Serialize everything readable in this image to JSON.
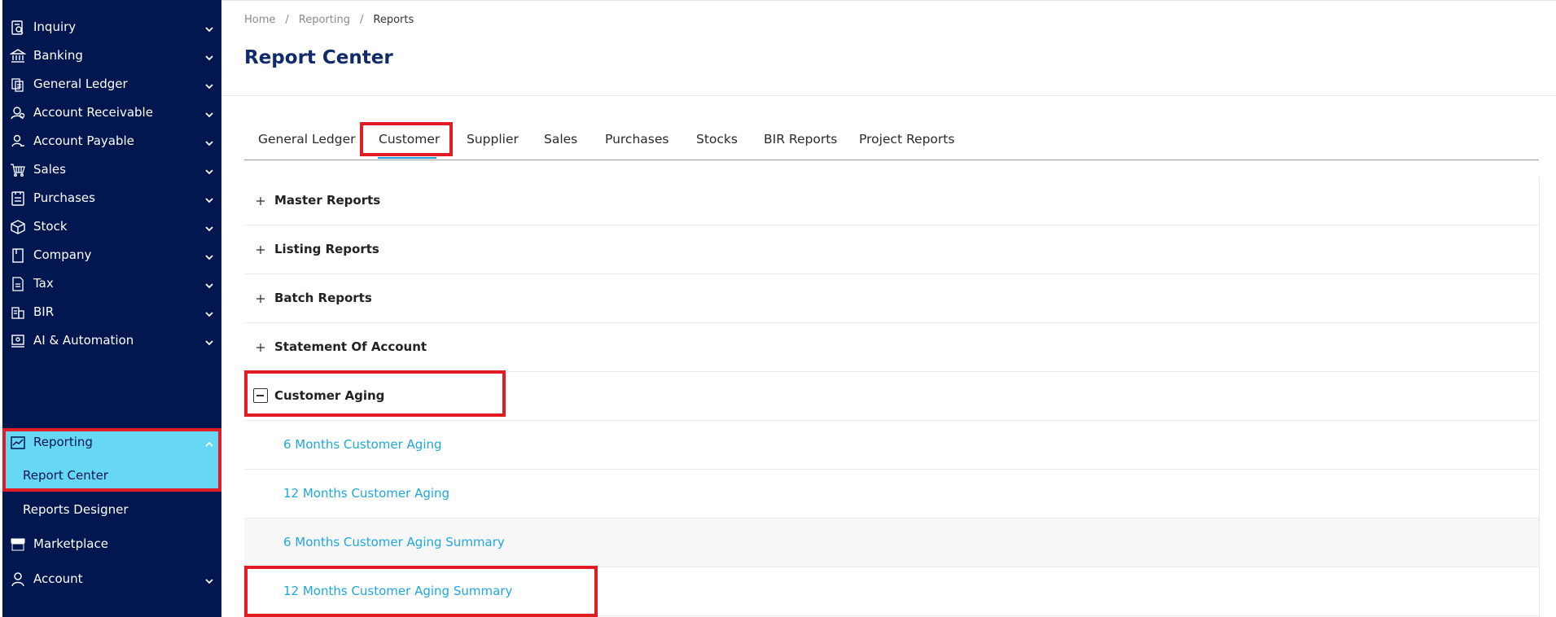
{
  "sidebar": {
    "items": [
      {
        "label": "Inquiry",
        "icon": "inquiry-icon"
      },
      {
        "label": "Banking",
        "icon": "bank-icon"
      },
      {
        "label": "General Ledger",
        "icon": "ledger-icon"
      },
      {
        "label": "Account Receivable",
        "icon": "receivable-icon"
      },
      {
        "label": "Account Payable",
        "icon": "payable-icon"
      },
      {
        "label": "Sales",
        "icon": "cart-icon"
      },
      {
        "label": "Purchases",
        "icon": "purchases-icon"
      },
      {
        "label": "Stock",
        "icon": "box-icon"
      },
      {
        "label": "Company",
        "icon": "company-icon"
      },
      {
        "label": "Tax",
        "icon": "tax-icon"
      },
      {
        "label": "BIR",
        "icon": "bir-icon"
      },
      {
        "label": "AI & Automation",
        "icon": "ai-icon"
      },
      {
        "label": "Reporting",
        "icon": "chart-line-icon"
      },
      {
        "label": "Marketplace",
        "icon": "store-icon"
      },
      {
        "label": "Account",
        "icon": "user-icon"
      }
    ],
    "reporting_sub": [
      "Report Center",
      "Reports Designer"
    ]
  },
  "breadcrumb": [
    "Home",
    "Reporting",
    "Reports"
  ],
  "page_title": "Report Center",
  "tabs": [
    "General Ledger",
    "Customer",
    "Supplier",
    "Sales",
    "Purchases",
    "Stocks",
    "BIR Reports",
    "Project Reports"
  ],
  "active_tab": "Customer",
  "sections": [
    "Master Reports",
    "Listing Reports",
    "Batch Reports",
    "Statement Of Account",
    "Customer Aging"
  ],
  "aging_links": [
    "6 Months Customer Aging",
    "12 Months Customer Aging",
    "6 Months Customer Aging Summary",
    "12 Months Customer Aging Summary"
  ],
  "colors": {
    "sidebar_bg": "#021650",
    "active_bg": "#67d8f3",
    "highlight": "#e11c24",
    "link": "#1ea7e1",
    "title": "#102a6a"
  }
}
